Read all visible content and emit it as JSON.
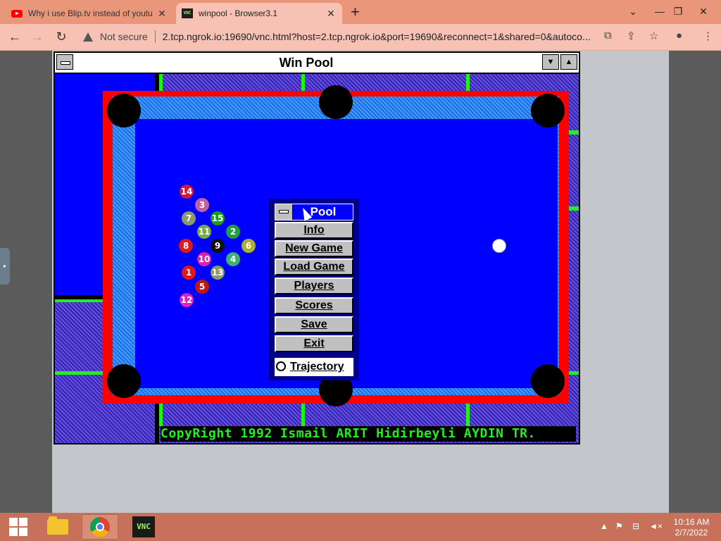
{
  "browser": {
    "tabs": [
      {
        "title": "Why i use Blip.tv instead of youtu",
        "icon": "youtube-icon",
        "active": false
      },
      {
        "title": "winpool - Browser3.1",
        "icon": "vnc-icon",
        "active": true
      }
    ],
    "new_tab_label": "+",
    "security_label": "Not secure",
    "url": "2.tcp.ngrok.io:19690/vnc.html?host=2.tcp.ngrok.io&port=19690&reconnect=1&shared=0&autoco..."
  },
  "winpool": {
    "title": "Win Pool",
    "copyright": "CopyRight 1992 Ismail ARIT  Hidirbeyli AYDIN TR.",
    "balls": [
      {
        "n": "14",
        "color": "#d4163c"
      },
      {
        "n": "3",
        "color": "#c060a0"
      },
      {
        "n": "7",
        "color": "#8a9a6a"
      },
      {
        "n": "15",
        "color": "#1aa01a"
      },
      {
        "n": "11",
        "color": "#7aaa4a"
      },
      {
        "n": "2",
        "color": "#22a040"
      },
      {
        "n": "8",
        "color": "#e01818"
      },
      {
        "n": "9",
        "color": "#111111"
      },
      {
        "n": "6",
        "color": "#b0b030"
      },
      {
        "n": "10",
        "color": "#e020a8"
      },
      {
        "n": "4",
        "color": "#40b070"
      },
      {
        "n": "1",
        "color": "#e01818"
      },
      {
        "n": "13",
        "color": "#8a9a6a"
      },
      {
        "n": "5",
        "color": "#c01818"
      },
      {
        "n": "12",
        "color": "#e020c0"
      }
    ],
    "pool_menu": {
      "title": "Pool",
      "buttons": [
        "Info",
        "New Game",
        "Load Game",
        "Players",
        "Scores",
        "Save",
        "Exit"
      ],
      "trajectory_label": "Trajectory"
    }
  },
  "taskbar": {
    "time": "10:16 AM",
    "date": "2/7/2022",
    "vnc_label": "VNC"
  }
}
